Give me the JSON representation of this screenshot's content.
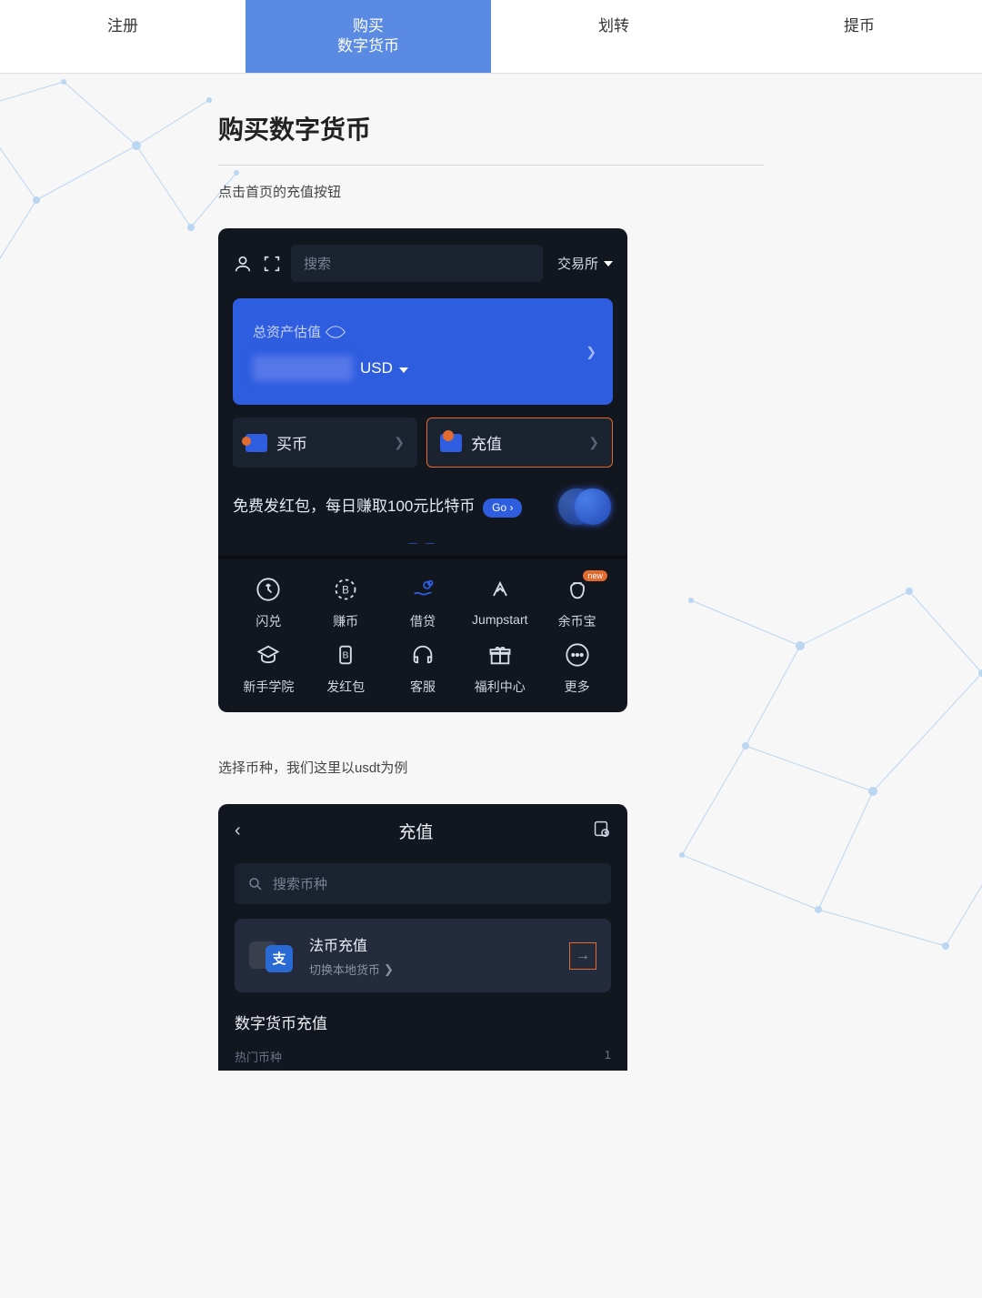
{
  "tabs": [
    "注册",
    "购买\n数字货币",
    "划转",
    "提币"
  ],
  "activeTab": 1,
  "page": {
    "title": "购买数字货币",
    "instruction1": "点击首页的充值按钮",
    "instruction2": "选择币种，我们这里以usdt为例"
  },
  "mock1": {
    "searchPlaceholder": "搜索",
    "exchangeLabel": "交易所",
    "assetsLabel": "总资产估值",
    "currency": "USD",
    "buyLabel": "买币",
    "depositLabel": "充值",
    "bannerText": "免费发红包，每日赚取100元比特币",
    "goLabel": "Go",
    "gridItems": [
      "闪兑",
      "赚币",
      "借贷",
      "Jumpstart",
      "余币宝",
      "新手学院",
      "发红包",
      "客服",
      "福利中心",
      "更多"
    ],
    "newBadge": "new"
  },
  "mock2": {
    "title": "充值",
    "searchPlaceholder": "搜索币种",
    "fiatTitle": "法币充值",
    "fiatSub": "切换本地货币",
    "fiatIconText": "支",
    "sectionTitle": "数字货币充值",
    "hotLabel": "热门币种",
    "hotCount": "1"
  }
}
